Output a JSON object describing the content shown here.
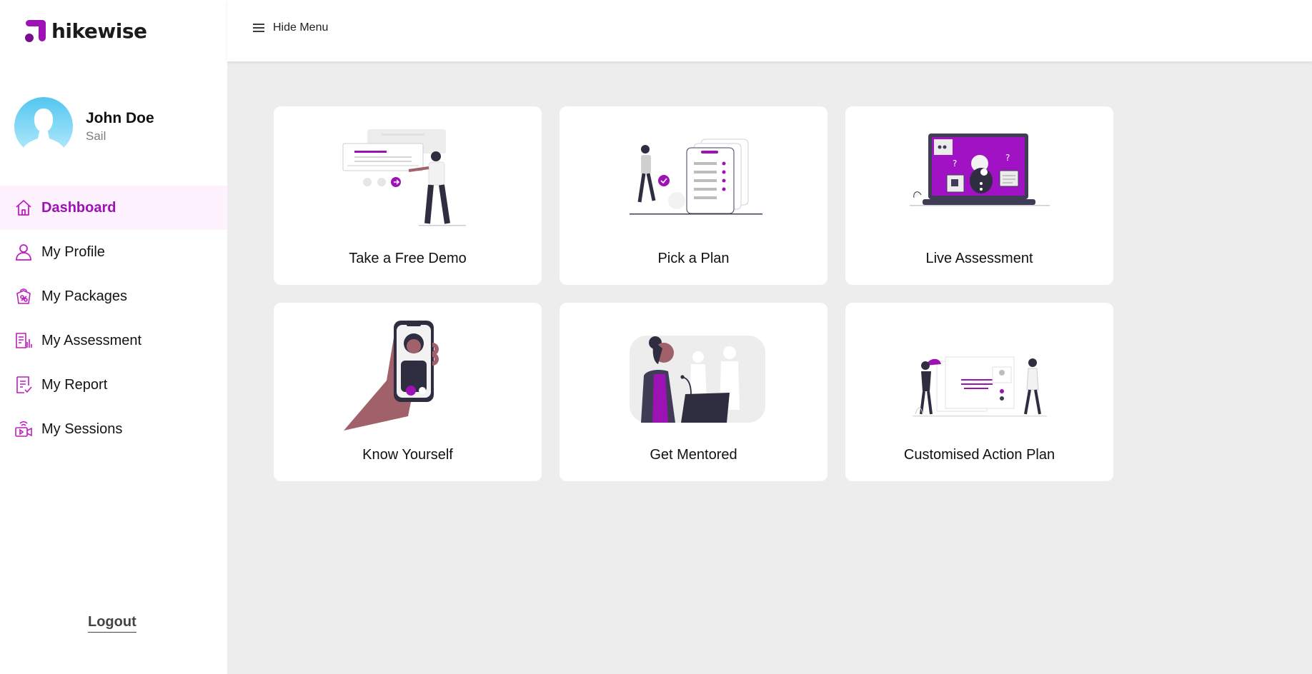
{
  "brand": {
    "name": "hikewise",
    "accent": "#9c12b4",
    "accent_dark": "#7a0d8d"
  },
  "user": {
    "name": "John Doe",
    "role": "Sail"
  },
  "nav": {
    "items": [
      {
        "label": "Dashboard",
        "icon": "home-icon",
        "active": true
      },
      {
        "label": "My Profile",
        "icon": "user-icon",
        "active": false
      },
      {
        "label": "My Packages",
        "icon": "package-icon",
        "active": false
      },
      {
        "label": "My Assessment",
        "icon": "assessment-icon",
        "active": false
      },
      {
        "label": "My Report",
        "icon": "report-icon",
        "active": false
      },
      {
        "label": "My Sessions",
        "icon": "sessions-icon",
        "active": false
      }
    ],
    "logout_label": "Logout"
  },
  "topbar": {
    "menu_label": "Hide Menu",
    "menu_icon": "hamburger-icon"
  },
  "cards": [
    {
      "label": "Take a Free Demo",
      "illustration": "free-demo-illustration"
    },
    {
      "label": "Pick a Plan",
      "illustration": "pick-plan-illustration"
    },
    {
      "label": "Live Assessment",
      "illustration": "live-assessment-illustration"
    },
    {
      "label": "Know Yourself",
      "illustration": "know-yourself-illustration"
    },
    {
      "label": "Get Mentored",
      "illustration": "get-mentored-illustration"
    },
    {
      "label": "Customised Action Plan",
      "illustration": "action-plan-illustration"
    }
  ]
}
